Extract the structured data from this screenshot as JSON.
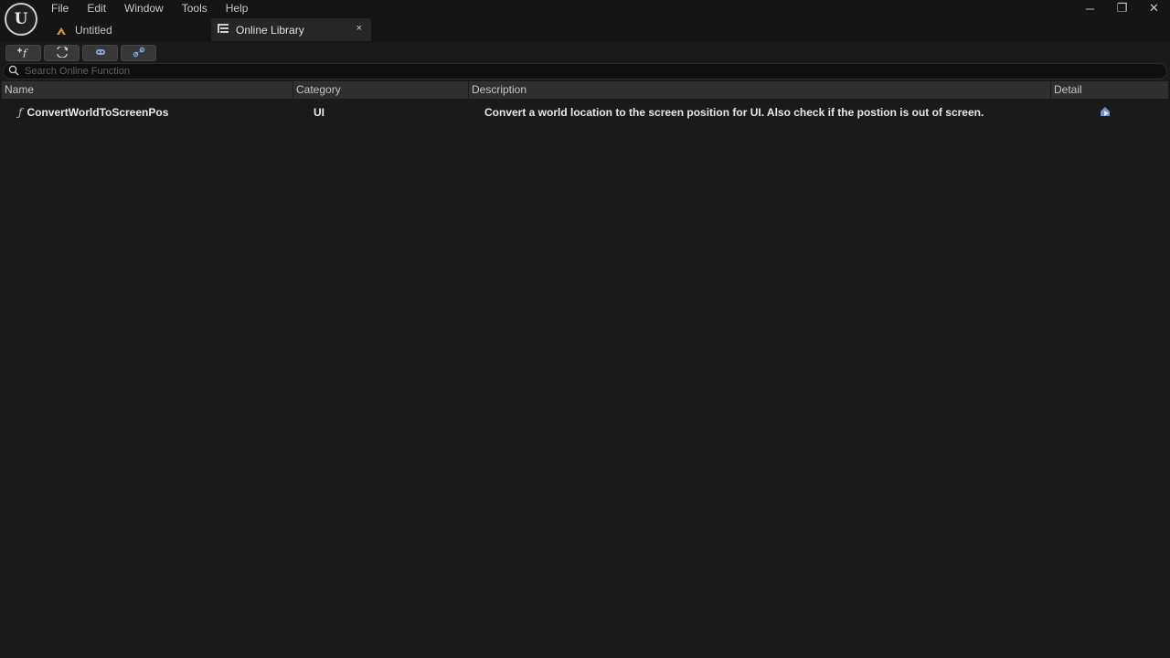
{
  "app": {
    "logo_label": "U"
  },
  "menu": [
    "File",
    "Edit",
    "Window",
    "Tools",
    "Help"
  ],
  "tabs": {
    "document": {
      "label": "Untitled",
      "icon": "ue-project-icon"
    },
    "active": {
      "label": "Online Library",
      "icon": "list-icon",
      "close_glyph": "×"
    }
  },
  "window_controls": {
    "minimize": "─",
    "restore": "❐",
    "close": "✕"
  },
  "toolbar": {
    "buttons": [
      {
        "name": "add-function-button",
        "icon": "add-function-icon"
      },
      {
        "name": "refresh-button",
        "icon": "refresh-icon"
      },
      {
        "name": "gamepad-button",
        "icon": "gamepad-icon"
      },
      {
        "name": "link-button",
        "icon": "link-icon"
      }
    ]
  },
  "search": {
    "placeholder": "Search Online Function",
    "value": ""
  },
  "table": {
    "columns": [
      "Name",
      "Category",
      "Description",
      "Detail"
    ],
    "rows": [
      {
        "name": "ConvertWorldToScreenPos",
        "category": "UI",
        "description": "Convert a world location to the screen position for UI. Also check if the postion is out of screen.",
        "detail_icon": "detail-icon"
      }
    ]
  },
  "colors": {
    "background": "#1a1a1a",
    "titlebar": "#151515",
    "header": "#2f2f2f",
    "accent": "#6f8fd8"
  }
}
